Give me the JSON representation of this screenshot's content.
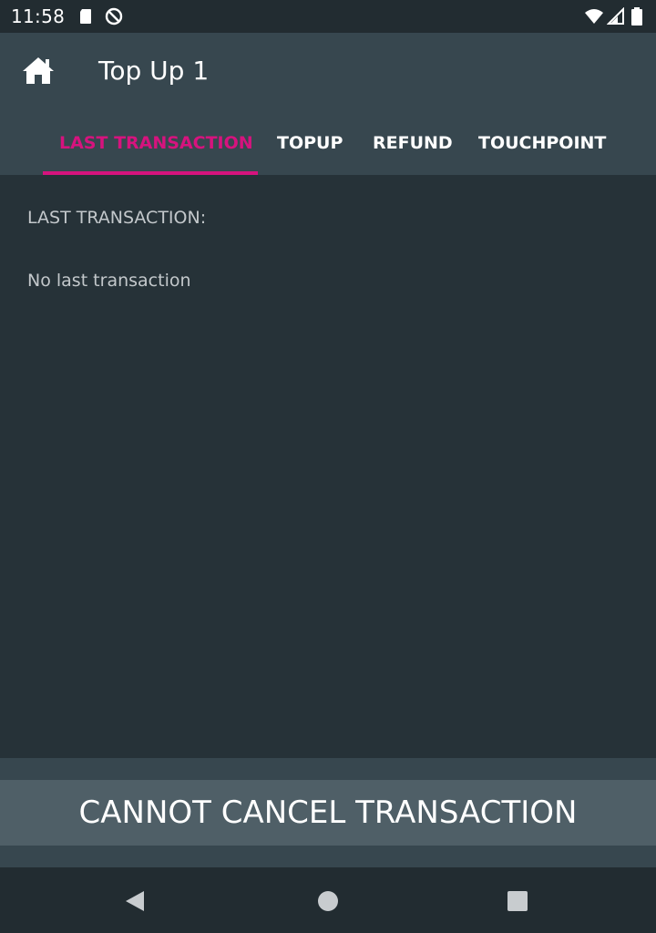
{
  "status_bar": {
    "time": "11:58",
    "icons": [
      "sd-card-icon",
      "do-not-disturb-icon",
      "wifi-icon",
      "cellular-signal-icon",
      "battery-icon"
    ]
  },
  "app_bar": {
    "home_icon": "home-icon",
    "title": "Top Up 1"
  },
  "tabs": [
    {
      "label": "LAST TRANSACTION",
      "active": true
    },
    {
      "label": "TOPUP",
      "active": false
    },
    {
      "label": "REFUND",
      "active": false
    },
    {
      "label": "TOUCHPOINT",
      "active": false
    }
  ],
  "content": {
    "section_label": "LAST TRANSACTION:",
    "empty_text": "No last transaction"
  },
  "bottom": {
    "cancel_label": "CANNOT CANCEL TRANSACTION"
  },
  "nav_bar": {
    "icons": [
      "back-icon",
      "home-circle-icon",
      "recents-icon"
    ]
  },
  "colors": {
    "accent": "#d6137e",
    "app_bar": "#37474f",
    "background": "#263238",
    "button": "#4f5f67"
  }
}
